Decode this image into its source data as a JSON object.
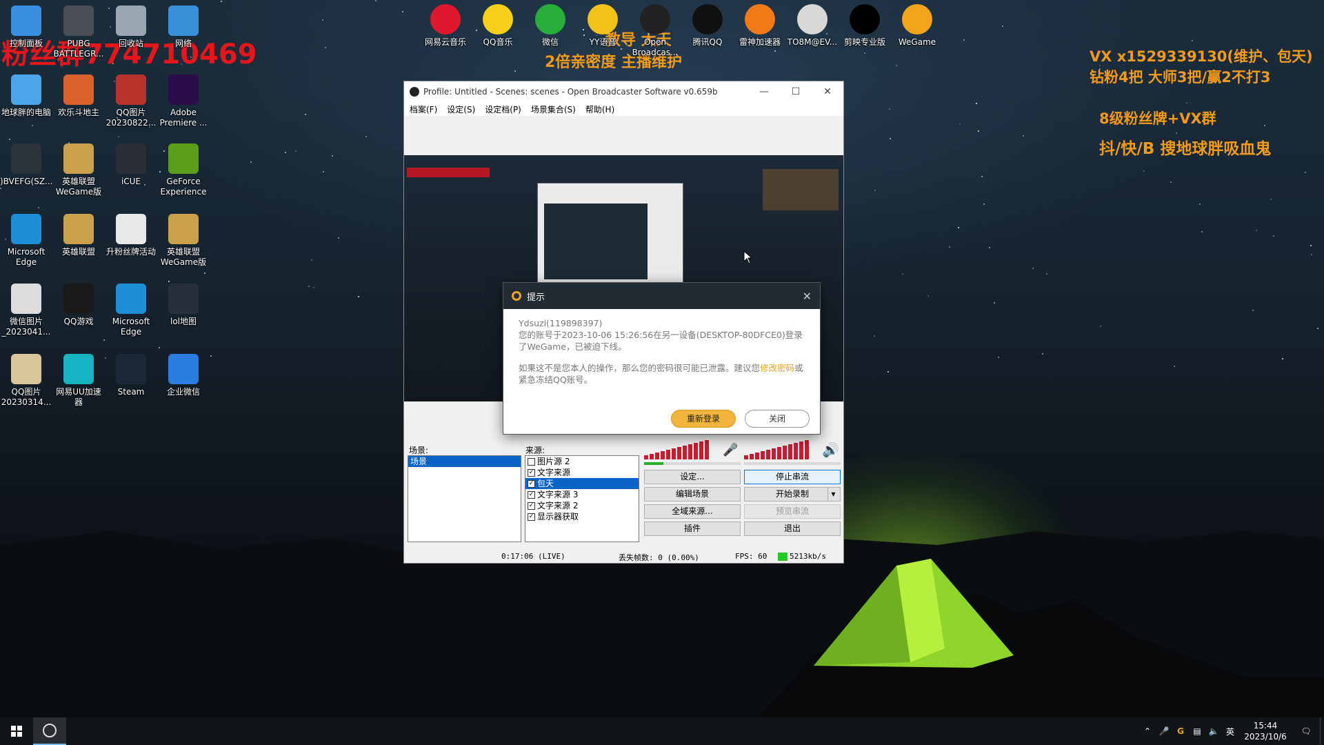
{
  "desktop_icons": [
    {
      "label": "控制面板",
      "icon": "control-panel-icon",
      "color": "#3a8ee0"
    },
    {
      "label": "PUBG BATTLEGR...",
      "icon": "pubg-icon",
      "color": "#4a4f55"
    },
    {
      "label": "回收站",
      "icon": "recycle-bin-icon",
      "color": "#9aa6b2"
    },
    {
      "label": "网络",
      "icon": "network-icon",
      "color": "#3a90d8"
    },
    {
      "label": "地球胖的电脑",
      "icon": "computer-icon",
      "color": "#4aa6e8"
    },
    {
      "label": "欢乐斗地主",
      "icon": "doudizhu-icon",
      "color": "#d8622a"
    },
    {
      "label": "QQ图片 20230822...",
      "icon": "image-file-icon",
      "color": "#b8342a"
    },
    {
      "label": "Adobe Premiere ...",
      "icon": "premiere-icon",
      "color": "#2a0d4a"
    },
    {
      "label": ")BVEFG(SZ...",
      "icon": "screenshot-file-icon",
      "color": "#2a323a"
    },
    {
      "label": "英雄联盟 WeGame版",
      "icon": "lol-icon",
      "color": "#c9a14a"
    },
    {
      "label": "iCUE",
      "icon": "icue-icon",
      "color": "#2a2f35"
    },
    {
      "label": "GeForce Experience",
      "icon": "geforce-icon",
      "color": "#5a9e1a"
    },
    {
      "label": "Microsoft Edge",
      "icon": "edge-icon",
      "color": "#1e8fd6"
    },
    {
      "label": "英雄联盟",
      "icon": "lol-icon",
      "color": "#c9a14a"
    },
    {
      "label": "升粉丝牌活动",
      "icon": "text-file-icon",
      "color": "#e8e8e8"
    },
    {
      "label": "英雄联盟 WeGame版",
      "icon": "lol-icon",
      "color": "#c9a14a"
    },
    {
      "label": "微信图片 _2023041...",
      "icon": "image-file-icon",
      "color": "#dcdcdc"
    },
    {
      "label": "QQ游戏",
      "icon": "qq-game-icon",
      "color": "#1a1a1a"
    },
    {
      "label": "Microsoft Edge",
      "icon": "edge-icon",
      "color": "#1e8fd6"
    },
    {
      "label": "lol地图",
      "icon": "map-file-icon",
      "color": "#27303a"
    },
    {
      "label": "QQ图片 20230314...",
      "icon": "image-file-icon",
      "color": "#d8c59a"
    },
    {
      "label": "网易UU加速器",
      "icon": "uu-booster-icon",
      "color": "#17b3c2"
    },
    {
      "label": "Steam",
      "icon": "steam-icon",
      "color": "#1b2838"
    },
    {
      "label": "企业微信",
      "icon": "wecom-icon",
      "color": "#2b7de0"
    }
  ],
  "top_icons": [
    {
      "label": "网易云音乐",
      "icon": "netease-music-icon",
      "color": "#e0182d"
    },
    {
      "label": "QQ音乐",
      "icon": "qq-music-icon",
      "color": "#f5cf18"
    },
    {
      "label": "微信",
      "icon": "wechat-icon",
      "color": "#2aae3a"
    },
    {
      "label": "YY语音",
      "icon": "yy-voice-icon",
      "color": "#f3c218"
    },
    {
      "label": "Open Broadcas...",
      "icon": "obs-icon",
      "color": "#222222"
    },
    {
      "label": "腾讯QQ",
      "icon": "qq-icon",
      "color": "#111111"
    },
    {
      "label": "雷神加速器",
      "icon": "leishen-icon",
      "color": "#f07a18"
    },
    {
      "label": "TO8M@EV...",
      "icon": "cat-file-icon",
      "color": "#d8d8d8"
    },
    {
      "label": "剪映专业版",
      "icon": "capcut-icon",
      "color": "#000000"
    },
    {
      "label": "WeGame",
      "icon": "wegame-icon",
      "color": "#f2a41a"
    }
  ],
  "overlays": {
    "fans_text": "粉丝群774710469",
    "center_line1": "教导 大天",
    "center_line2": "2倍亲密度 主播维护",
    "right_line1": "VX x1529339130(维护、包天)",
    "right_line2": "钻粉4把 大师3把/赢2不打3",
    "right_line3": "8级粉丝牌+VX群",
    "right_line4": "抖/快/B 搜地球胖吸血鬼"
  },
  "obs": {
    "title": "Profile: Untitled - Scenes: scenes - Open Broadcaster Software v0.659b",
    "menu": [
      "档案(F)",
      "设定(S)",
      "设定档(P)",
      "场景集合(S)",
      "帮助(H)"
    ],
    "scenes_label": "场景:",
    "scenes": [
      "场景"
    ],
    "sources_label": "来源:",
    "sources": [
      {
        "name": "图片源 2",
        "checked": false
      },
      {
        "name": "文字来源",
        "checked": true
      },
      {
        "name": "包天",
        "checked": true,
        "selected": true
      },
      {
        "name": "文字来源 3",
        "checked": true
      },
      {
        "name": "文字来源 2",
        "checked": true
      },
      {
        "name": "显示器获取",
        "checked": true
      }
    ],
    "buttons": {
      "settings": "设定...",
      "stop_stream": "停止串流",
      "edit_scene": "编辑场景",
      "start_record": "开始录制",
      "global_sources": "全域来源...",
      "preview_stream": "预览串流",
      "plugins": "插件",
      "exit": "退出"
    },
    "status": {
      "time": "0:17:06 (LIVE)",
      "dropped": "丢失帧数: 0 (0.00%)",
      "fps": "FPS: 60",
      "bitrate": "5213kb/s"
    },
    "bitrate_color": "#22cc22"
  },
  "dialog": {
    "title": "提示",
    "account": "Ydsuzi(119898397)",
    "message": "您的账号于2023-10-06 15:26:56在另一设备(DESKTOP-80DFCE0)登录了WeGame，已被迫下线。",
    "warning_prefix": "如果这不是您本人的操作，那么您的密码很可能已泄露。建议您",
    "warning_link": "修改密码",
    "warning_suffix": "或紧急冻结QQ账号。",
    "relogin": "重新登录",
    "close": "关闭",
    "accent": "#f2b43a"
  },
  "taskbar": {
    "ime": "英",
    "time": "15:44",
    "date": "2023/10/6"
  }
}
